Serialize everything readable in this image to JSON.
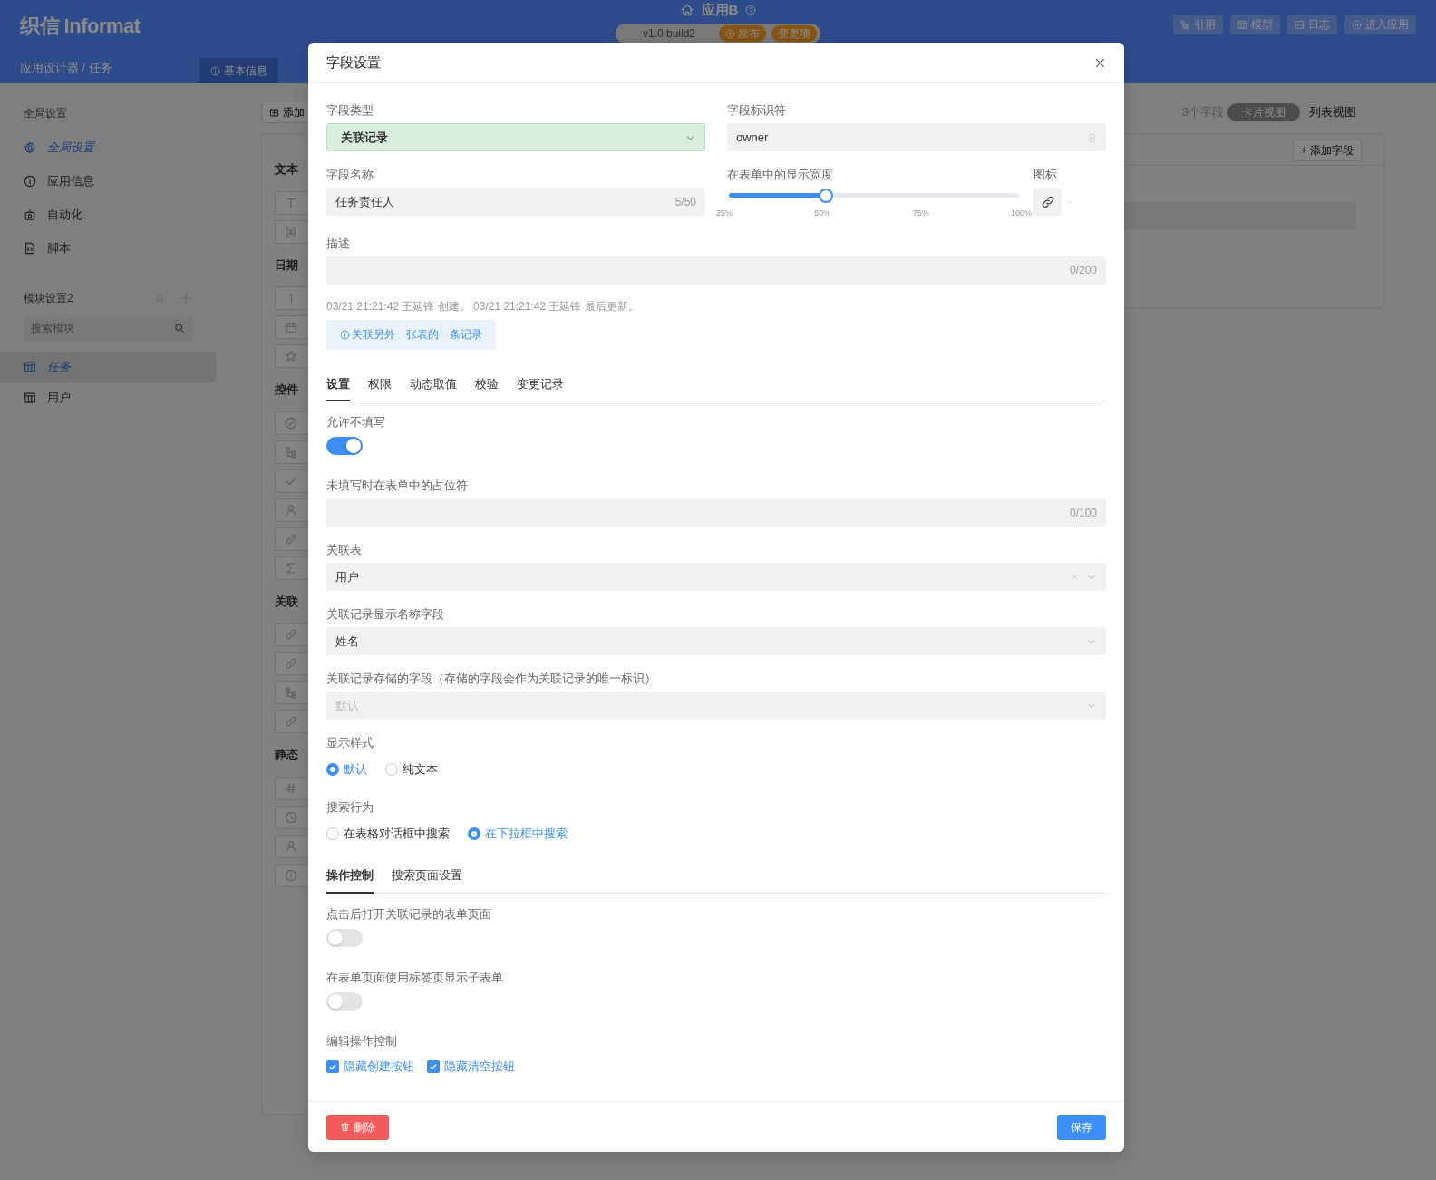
{
  "header": {
    "logo": "织信 Informat",
    "breadcrumb": "应用设计器 / 任务",
    "app_title": "应用B",
    "version": "v1.0 build2",
    "publish": "发布",
    "changes": "变更项",
    "actions": [
      {
        "label": "引用"
      },
      {
        "label": "模型"
      },
      {
        "label": "日志"
      },
      {
        "label": "进入应用"
      }
    ],
    "tab": "基本信息"
  },
  "sidebar": {
    "global_title": "全局设置",
    "global_items": [
      {
        "label": "全局设置",
        "selected": true
      },
      {
        "label": "应用信息",
        "selected": false
      },
      {
        "label": "自动化",
        "selected": false
      },
      {
        "label": "脚本",
        "selected": false
      }
    ],
    "module_title": "模块设置2",
    "search": {
      "placeholder": "搜索模块"
    },
    "modules": [
      {
        "label": "任务",
        "selected": true
      },
      {
        "label": "用户",
        "selected": false
      }
    ]
  },
  "designer": {
    "add_button": "添加",
    "field_count": "3个字段",
    "views": [
      {
        "label": "卡片视图",
        "selected": true
      },
      {
        "label": "列表视图",
        "selected": false
      }
    ],
    "add_field": "+ 添加字段",
    "groups": [
      {
        "title": "文本",
        "items": [
          {
            "kind": "text"
          },
          {
            "kind": "doc"
          }
        ]
      },
      {
        "title": "日期",
        "items": [
          {
            "kind": "number"
          },
          {
            "kind": "calendar"
          },
          {
            "kind": "star"
          }
        ]
      },
      {
        "title": "控件",
        "items": [
          {
            "kind": "check-circle"
          },
          {
            "kind": "tree"
          },
          {
            "kind": "check"
          },
          {
            "kind": "person"
          },
          {
            "kind": "pencil"
          },
          {
            "kind": "sigma"
          }
        ]
      },
      {
        "title": "关联",
        "items": [
          {
            "kind": "link"
          },
          {
            "kind": "link"
          },
          {
            "kind": "tree"
          },
          {
            "kind": "link"
          }
        ]
      },
      {
        "title": "静态",
        "items": [
          {
            "kind": "hash"
          },
          {
            "kind": "clock"
          },
          {
            "kind": "person"
          },
          {
            "kind": "info"
          }
        ]
      }
    ]
  },
  "dialog": {
    "title": "字段设置",
    "field_type": {
      "label": "字段类型",
      "value": "关联记录"
    },
    "identifier": {
      "label": "字段标识符",
      "value": "owner"
    },
    "name": {
      "label": "字段名称",
      "value": "任务责任人",
      "counter": "5/50"
    },
    "width": {
      "label": "在表单中的显示宽度",
      "level": 0.333,
      "ticks": [
        "25%",
        "50%",
        "75%",
        "100%"
      ]
    },
    "icon": {
      "label": "图标"
    },
    "description": {
      "label": "描述",
      "counter": "0/200"
    },
    "meta": "03/21 21:21:42 王延锋 创建。 03/21 21:21:42 王延锋 最后更新。",
    "hint": "关联另外一张表的一条记录",
    "tabs": [
      {
        "label": "设置",
        "selected": true
      },
      {
        "label": "权限",
        "selected": false
      },
      {
        "label": "动态取值",
        "selected": false
      },
      {
        "label": "校验",
        "selected": false
      },
      {
        "label": "变更记录",
        "selected": false
      }
    ],
    "settings": [
      {
        "kind": "toggle",
        "label": "允许不填写",
        "on": true
      },
      {
        "kind": "text",
        "label": "未填写时在表单中的占位符",
        "counter": "0/100"
      },
      {
        "kind": "select",
        "label": "关联表",
        "value": "用户",
        "clearable": true
      },
      {
        "kind": "select",
        "label": "关联记录显示名称字段",
        "value": "姓名"
      },
      {
        "kind": "select",
        "label": "关联记录存储的字段（存储的字段会作为关联记录的唯一标识）",
        "placeholder": "默认"
      },
      {
        "kind": "radio",
        "label": "显示样式",
        "options": [
          {
            "label": "默认",
            "selected": true
          },
          {
            "label": "纯文本",
            "selected": false
          }
        ]
      },
      {
        "kind": "radio",
        "label": "搜索行为",
        "options": [
          {
            "label": "在表格对话框中搜索",
            "selected": false
          },
          {
            "label": "在下拉框中搜索",
            "selected": true
          }
        ]
      },
      {
        "kind": "tabs",
        "tabs": [
          {
            "label": "操作控制",
            "selected": true
          },
          {
            "label": "搜索页面设置",
            "selected": false
          }
        ]
      },
      {
        "kind": "toggle",
        "label": "点击后打开关联记录的表单页面",
        "on": false
      },
      {
        "kind": "toggle",
        "label": "在表单页面使用标签页显示子表单",
        "on": false
      },
      {
        "kind": "checks",
        "label": "编辑操作控制",
        "options": [
          {
            "label": "隐藏创建按钮",
            "checked": true
          },
          {
            "label": "隐藏清空按钮",
            "checked": true
          }
        ]
      }
    ],
    "delete": "删除",
    "save": "保存"
  }
}
